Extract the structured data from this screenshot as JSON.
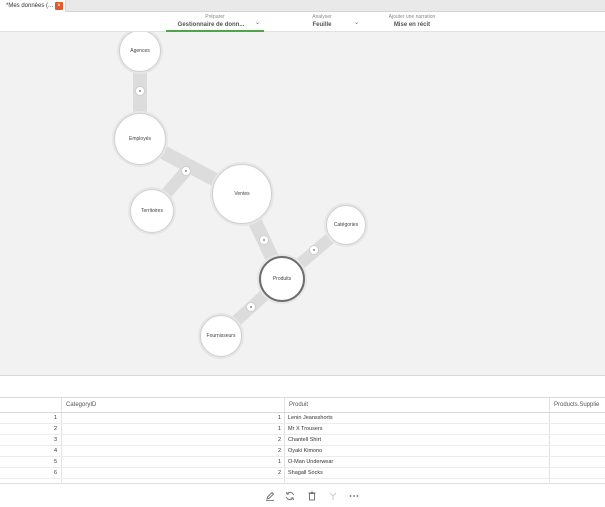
{
  "tab": {
    "label": "*Mes données (...",
    "close_glyph": "×"
  },
  "nav": {
    "prepare": {
      "small": "Préparer",
      "main": "Gestionnaire de donn..."
    },
    "analyze": {
      "small": "Analyser",
      "main": "Feuille"
    },
    "story": {
      "small": "Ajouter une narration",
      "main": "Mise en récit"
    },
    "chevron_glyph": "⌄"
  },
  "model": {
    "nodes": {
      "agences": "Agences",
      "employes": "Employés",
      "territoires": "Territoires",
      "ventes": "Ventes",
      "categories": "Catégories",
      "produits": "Produits",
      "fournisseurs": "Fournisseurs"
    }
  },
  "table": {
    "headers": {
      "category_id": "CategoryID",
      "produit": "Produit",
      "supplier": "Products.Supplie"
    },
    "rows": [
      {
        "index": "1",
        "category": "1",
        "produit": "Lenin Jeansshorts"
      },
      {
        "index": "2",
        "category": "1",
        "produit": "Mr X Trousers"
      },
      {
        "index": "3",
        "category": "2",
        "produit": "Chantell Shirt"
      },
      {
        "index": "4",
        "category": "2",
        "produit": "Oyaki Kimono"
      },
      {
        "index": "5",
        "category": "1",
        "produit": "O-Man Underwear"
      },
      {
        "index": "6",
        "category": "2",
        "produit": "Shagall Socks"
      }
    ]
  },
  "toolbar": {
    "edit_icon": "pencil-icon",
    "refresh_icon": "refresh-icon",
    "delete_icon": "trash-icon",
    "split_icon": "split-icon",
    "more_icon": "more-icon"
  },
  "colors": {
    "accent": "#52a44b",
    "close": "#e15a2b",
    "canvas": "#f2f2f2"
  }
}
